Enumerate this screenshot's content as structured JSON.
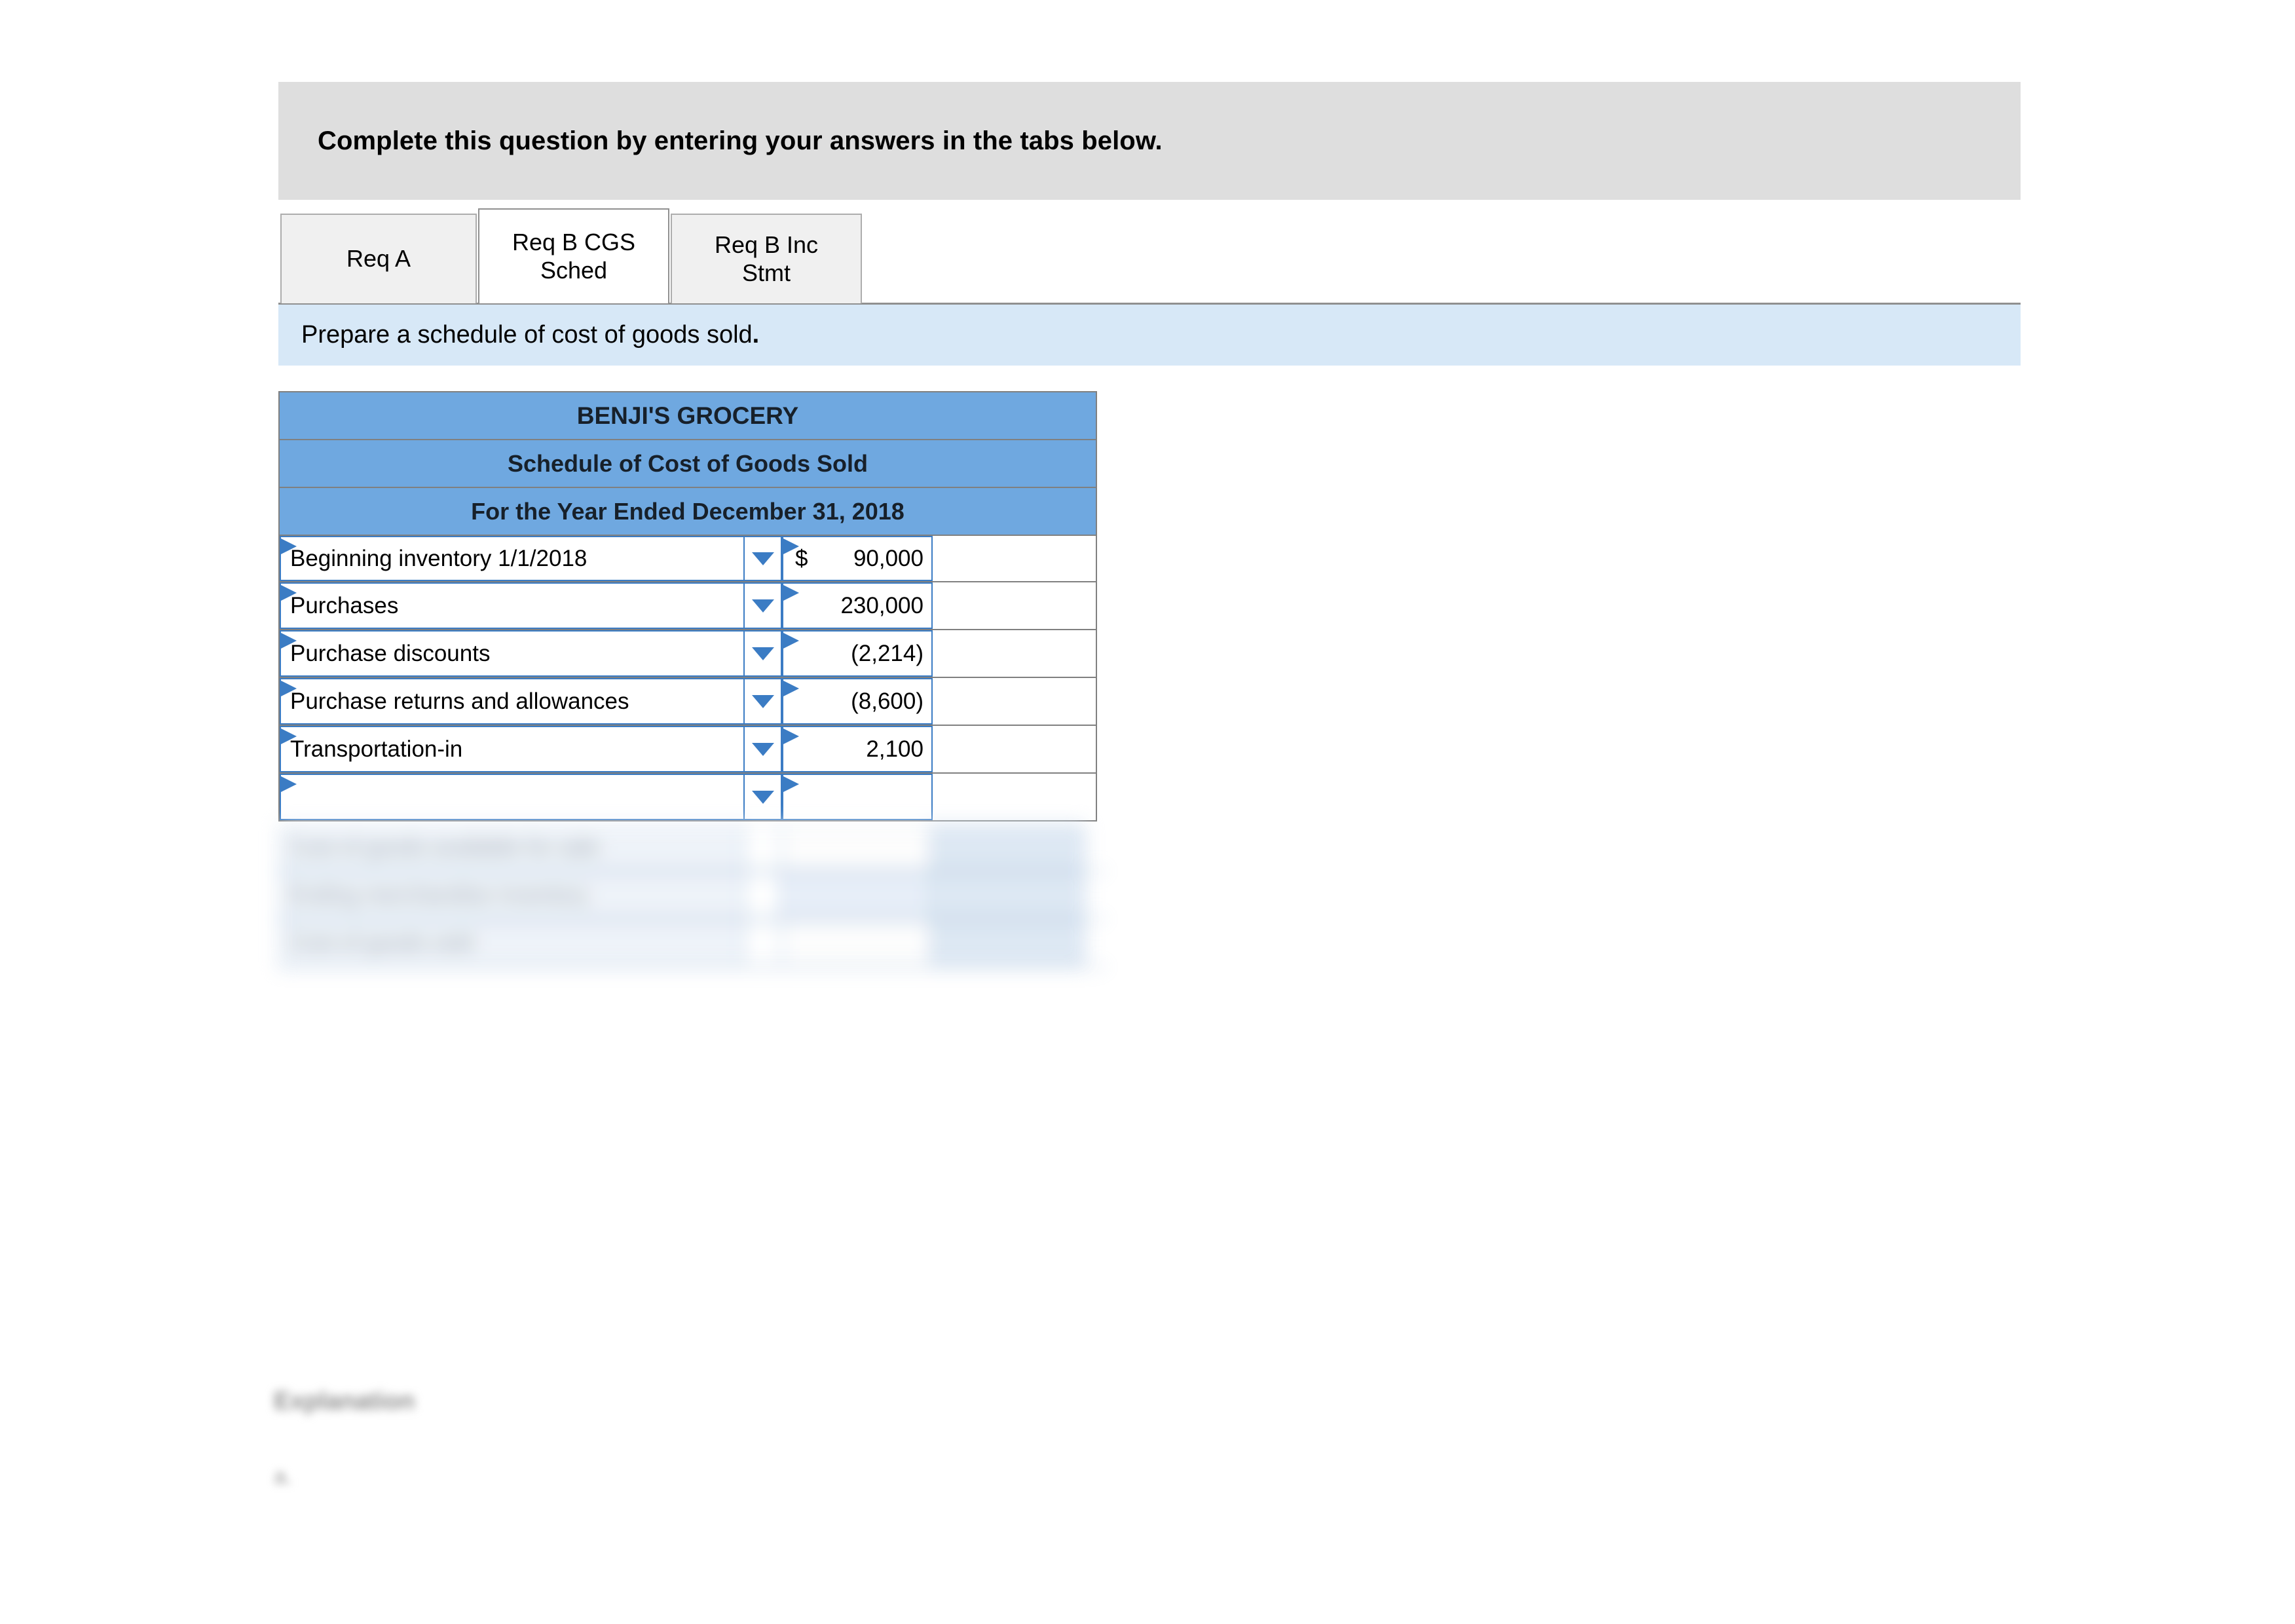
{
  "banner": {
    "instruction": "Complete this question by entering your answers in the tabs below."
  },
  "tabs": [
    {
      "label": "Req A",
      "active": false
    },
    {
      "label": "Req B CGS Sched",
      "active": true
    },
    {
      "label": "Req B Inc Stmt",
      "active": false
    }
  ],
  "tab_labels": {
    "req_a": "Req A",
    "req_b_cgs_line1": "Req B CGS",
    "req_b_cgs_line2": "Sched",
    "req_b_inc_line1": "Req B Inc",
    "req_b_inc_line2": "Stmt"
  },
  "requirement": {
    "text": "Prepare a schedule of cost of goods sold",
    "period": "."
  },
  "worksheet": {
    "title_line1": "BENJI'S GROCERY",
    "title_line2": "Schedule of Cost of Goods Sold",
    "title_line3": "For the Year Ended December 31, 2018",
    "rows": [
      {
        "label": "Beginning inventory 1/1/2018",
        "currency": "$",
        "amount": "90,000",
        "total": ""
      },
      {
        "label": "Purchases",
        "currency": "",
        "amount": "230,000",
        "total": ""
      },
      {
        "label": "Purchase discounts",
        "currency": "",
        "amount": "(2,214)",
        "total": ""
      },
      {
        "label": "Purchase returns and allowances",
        "currency": "",
        "amount": "(8,600)",
        "total": ""
      },
      {
        "label": "Transportation-in",
        "currency": "",
        "amount": "2,100",
        "total": ""
      },
      {
        "label": "",
        "currency": "",
        "amount": "",
        "total": ""
      }
    ],
    "obscured_rows": [
      {
        "label": "Cost of goods available for sale",
        "amount": "",
        "total": ""
      },
      {
        "label": "Ending merchandise inventory",
        "amount": "",
        "total": ""
      },
      {
        "label": "Cost of goods sold",
        "amount": "",
        "total": ""
      }
    ]
  },
  "explanation": {
    "heading": "Explanation",
    "mark": "a."
  },
  "icons": {
    "dropdown": "chevron-down-icon",
    "cell_marker": "cell-corner-marker-icon"
  },
  "colors": {
    "banner_gray": "#dedede",
    "requirement_blue": "#d7e8f7",
    "header_blue": "#6fa8e0",
    "cell_border_blue": "#3b7cc4",
    "grid_gray": "#808080"
  }
}
